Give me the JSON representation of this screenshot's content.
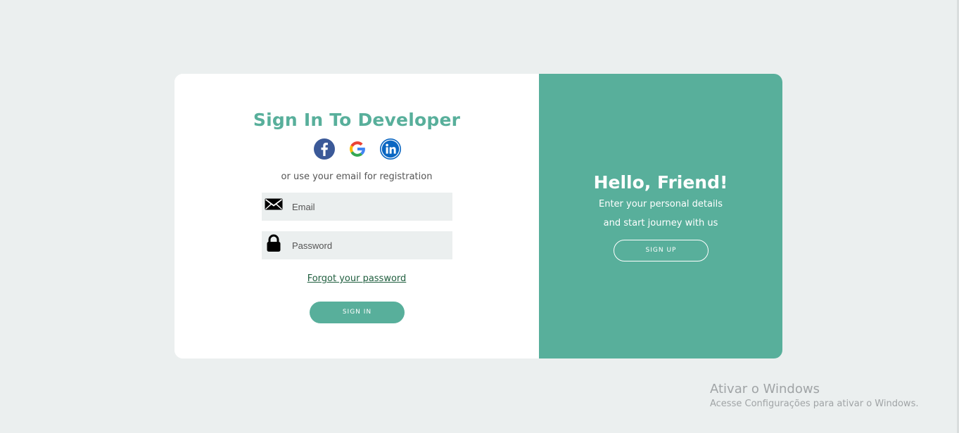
{
  "signin": {
    "title": "Sign In To Developer",
    "social": [
      "facebook-icon",
      "google-icon",
      "linkedin-icon"
    ],
    "subtitle": "or use your email for registration",
    "email_placeholder": "Email",
    "password_placeholder": "Password",
    "forgot_label": "Forgot your password",
    "button_label": "SIGN IN"
  },
  "overlay": {
    "title": "Hello, Friend!",
    "line1": "Enter your personal details",
    "line2": "and start journey with us",
    "button_label": "SIGN UP"
  },
  "watermark": {
    "title": "Ativar o Windows",
    "subtitle": "Acesse Configurações para ativar o Windows."
  },
  "colors": {
    "accent": "#58af9b",
    "page_background": "#ebefef",
    "input_background": "#ebefef",
    "link": "#1f5e3e",
    "facebook": "#3b5998",
    "linkedin": "#0a66c2"
  }
}
